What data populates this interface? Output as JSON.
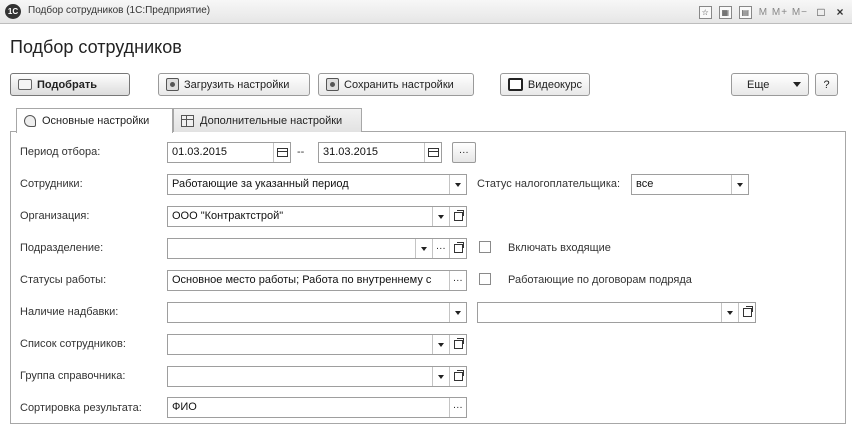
{
  "window": {
    "logo": "1С",
    "title": "Подбор сотрудников (1С:Предприятие)",
    "icons": [
      "star-icon",
      "calc-icon",
      "calendar-icon"
    ],
    "memory_buttons": "M  M+  M−",
    "restore": "□",
    "close": "×"
  },
  "form": {
    "title": "Подбор сотрудников"
  },
  "toolbar": {
    "select_label": "Подобрать",
    "load_label": "Загрузить настройки",
    "save_label": "Сохранить настройки",
    "video_label": "Видеокурс",
    "more_label": "Еще",
    "help_label": "?"
  },
  "tabs": [
    {
      "label": "Основные настройки",
      "icon": "brush-icon",
      "active": true
    },
    {
      "label": "Дополнительные настройки",
      "icon": "table-icon",
      "active": false
    }
  ],
  "fields": {
    "period": {
      "label": "Период отбора:",
      "from": "01.03.2015",
      "separator": "--",
      "to": "31.03.2015",
      "more": "..."
    },
    "employees": {
      "label": "Сотрудники:",
      "value": "Работающие за указанный период"
    },
    "tax_status": {
      "label": "Статус налогоплательщика:",
      "value": "все"
    },
    "organization": {
      "label": "Организация:",
      "value": "ООО \"Контрактстрой\""
    },
    "department": {
      "label": "Подразделение:",
      "value": ""
    },
    "include_incoming": {
      "label": "Включать входящие",
      "checked": false
    },
    "work_statuses": {
      "label": "Статусы работы:",
      "value": "Основное место работы; Работа по внутреннему с"
    },
    "contractors": {
      "label": "Работающие по договорам подряда",
      "checked": false
    },
    "bonus": {
      "label": "Наличие надбавки:",
      "value": "",
      "second_value": ""
    },
    "employee_list": {
      "label": "Список сотрудников:",
      "value": ""
    },
    "directory_group": {
      "label": "Группа справочника:",
      "value": ""
    },
    "sort": {
      "label": "Сортировка результата:",
      "value": "ФИО"
    }
  },
  "colors": {
    "border": "#9e9e9e",
    "tab_border": "#a7a7a7",
    "text": "#222222"
  }
}
